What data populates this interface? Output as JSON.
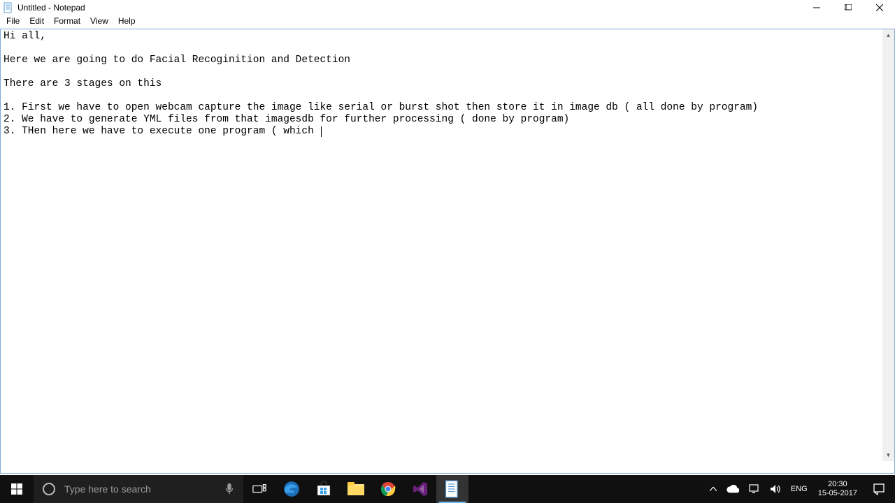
{
  "window": {
    "title": "Untitled - Notepad"
  },
  "menu": {
    "file": "File",
    "edit": "Edit",
    "format": "Format",
    "view": "View",
    "help": "Help"
  },
  "editor": {
    "content": "Hi all,\n\nHere we are going to do Facial Recoginition and Detection\n\nThere are 3 stages on this\n\n1. First we have to open webcam capture the image like serial or burst shot then store it in image db ( all done by program)\n2. We have to generate YML files from that imagesdb for further processing ( done by program)\n3. THen here we have to execute one program ( which "
  },
  "taskbar": {
    "search_placeholder": "Type here to search"
  },
  "tray": {
    "lang": "ENG",
    "time": "20:30",
    "date": "15-05-2017"
  }
}
